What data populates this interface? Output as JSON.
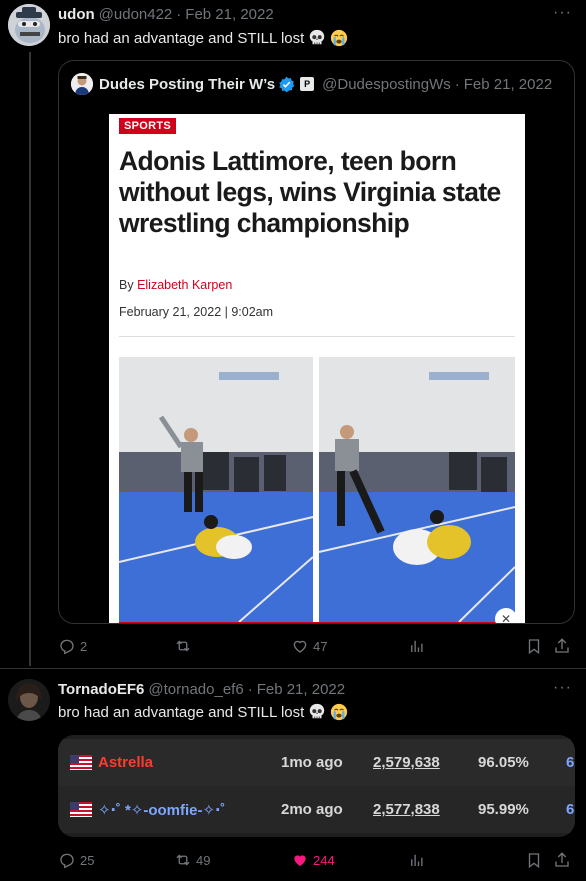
{
  "post1": {
    "display_name": "udon",
    "handle": "@udon422",
    "date": "Feb 21, 2022",
    "text": "bro had an advantage and STILL lost",
    "quote": {
      "display_name": "Dudes Posting Their W’s",
      "affiliate_badge": "P",
      "handle": "@DudespostingWs",
      "date": "Feb 21, 2022",
      "article": {
        "tag": "SPORTS",
        "headline": "Adonis Lattimore, teen born without legs, wins Virginia state wrestling championship",
        "by_prefix": "By ",
        "author": "Elizabeth Karpen",
        "dateline": "February 21, 2022 | 9:02am",
        "close_glyph": "✕"
      }
    },
    "actions": {
      "replies": "2",
      "reposts": "",
      "likes": "47"
    }
  },
  "post2": {
    "display_name": "TornadoEF6",
    "handle": "@tornado_ef6",
    "date": "Feb 21, 2022",
    "text": "bro had an advantage and STILL lost",
    "leaderboard": [
      {
        "name": "Astrella",
        "ago": "1mo ago",
        "score": "2,579,638",
        "pct": "96.05%",
        "cut": "6"
      },
      {
        "name": "✧‧˚ *✧-oomfie-✧‧˚",
        "ago": "2mo ago",
        "score": "2,577,838",
        "pct": "95.99%",
        "cut": "6"
      }
    ],
    "actions": {
      "replies": "25",
      "reposts": "49",
      "likes": "244"
    }
  },
  "more_glyph": "···",
  "separator": "·",
  "icons": [
    "skull-emoji",
    "sob-emoji",
    "reply-icon",
    "repost-icon",
    "heart-icon",
    "views-icon",
    "bookmark-icon",
    "share-icon",
    "verified-icon",
    "flag-us-icon"
  ],
  "colors": {
    "background": "#000000",
    "text": "#e7e9ea",
    "muted": "#71767b",
    "like": "#f91880",
    "verified": "#1d9bf0",
    "brand_red": "#d0021b"
  }
}
